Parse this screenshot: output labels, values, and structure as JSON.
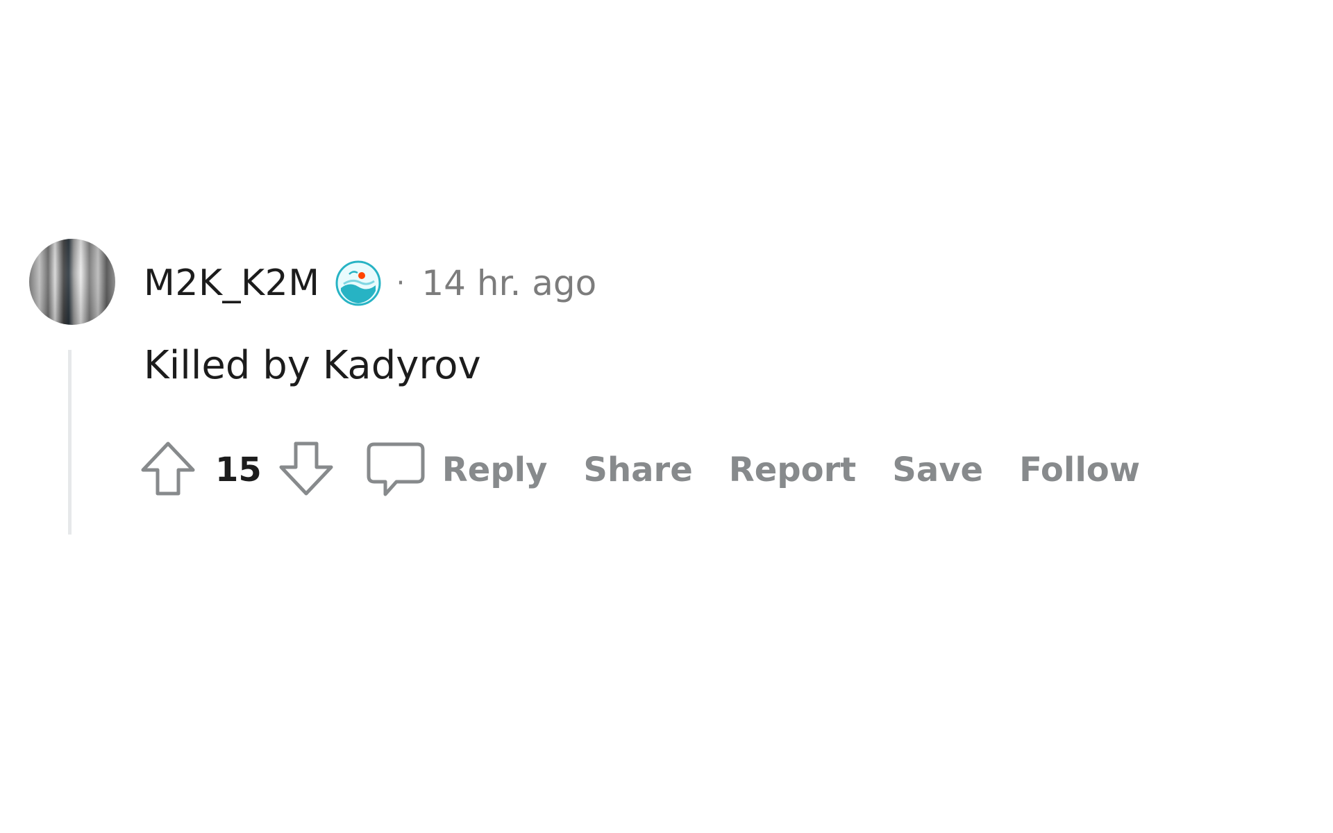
{
  "comment": {
    "author": "M2K_K2M",
    "separator": "·",
    "timestamp": "14 hr. ago",
    "body": "Killed by Kadyrov",
    "score": "15",
    "avatar_icon": "user-avatar",
    "flair_icon": "snoo-avatar-badge-icon"
  },
  "actions": {
    "upvote_icon": "upvote-arrow-icon",
    "downvote_icon": "downvote-arrow-icon",
    "comment_icon": "comment-bubble-icon",
    "reply": "Reply",
    "share": "Share",
    "report": "Report",
    "save": "Save",
    "follow": "Follow"
  },
  "colors": {
    "text_primary": "#1c1c1c",
    "text_secondary": "#7c7c7c",
    "action_gray": "#878a8c",
    "thread_line": "#e6e8ea",
    "flair_teal": "#27b3c4"
  }
}
